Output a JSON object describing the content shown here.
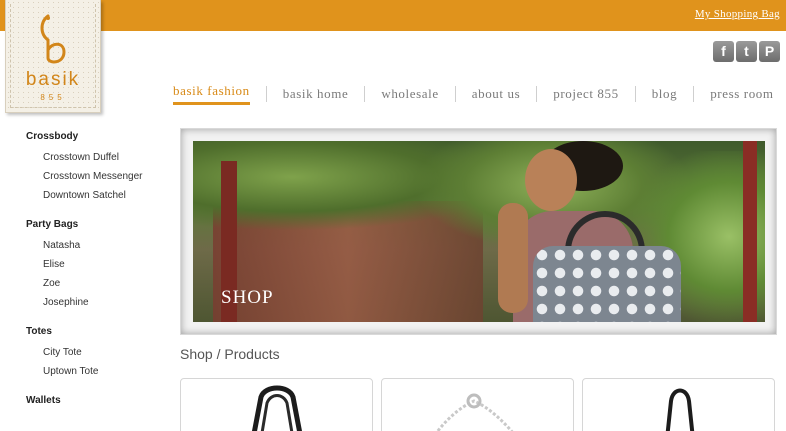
{
  "header": {
    "bag_link": "My Shopping Bag",
    "brand_color": "#e0931c"
  },
  "logo": {
    "name": "basik",
    "number": "855"
  },
  "social": [
    {
      "name": "facebook-icon",
      "glyph": "f"
    },
    {
      "name": "twitter-icon",
      "glyph": "t"
    },
    {
      "name": "pinterest-icon",
      "glyph": "P"
    }
  ],
  "nav": [
    {
      "label": "basik fashion",
      "active": true
    },
    {
      "label": "basik home",
      "active": false
    },
    {
      "label": "wholesale",
      "active": false
    },
    {
      "label": "about us",
      "active": false
    },
    {
      "label": "project 855",
      "active": false
    },
    {
      "label": "blog",
      "active": false
    },
    {
      "label": "press room",
      "active": false
    }
  ],
  "sidebar": [
    {
      "heading": "Crossbody",
      "items": [
        "Crosstown Duffel",
        "Crosstown Messenger",
        "Downtown Satchel"
      ]
    },
    {
      "heading": "Party Bags",
      "items": [
        "Natasha",
        "Elise",
        "Zoe",
        "Josephine"
      ]
    },
    {
      "heading": "Totes",
      "items": [
        "City Tote",
        "Uptown Tote"
      ]
    },
    {
      "heading": "Wallets",
      "items": []
    }
  ],
  "hero": {
    "label": "SHOP"
  },
  "main": {
    "section_title": "Shop / Products"
  }
}
